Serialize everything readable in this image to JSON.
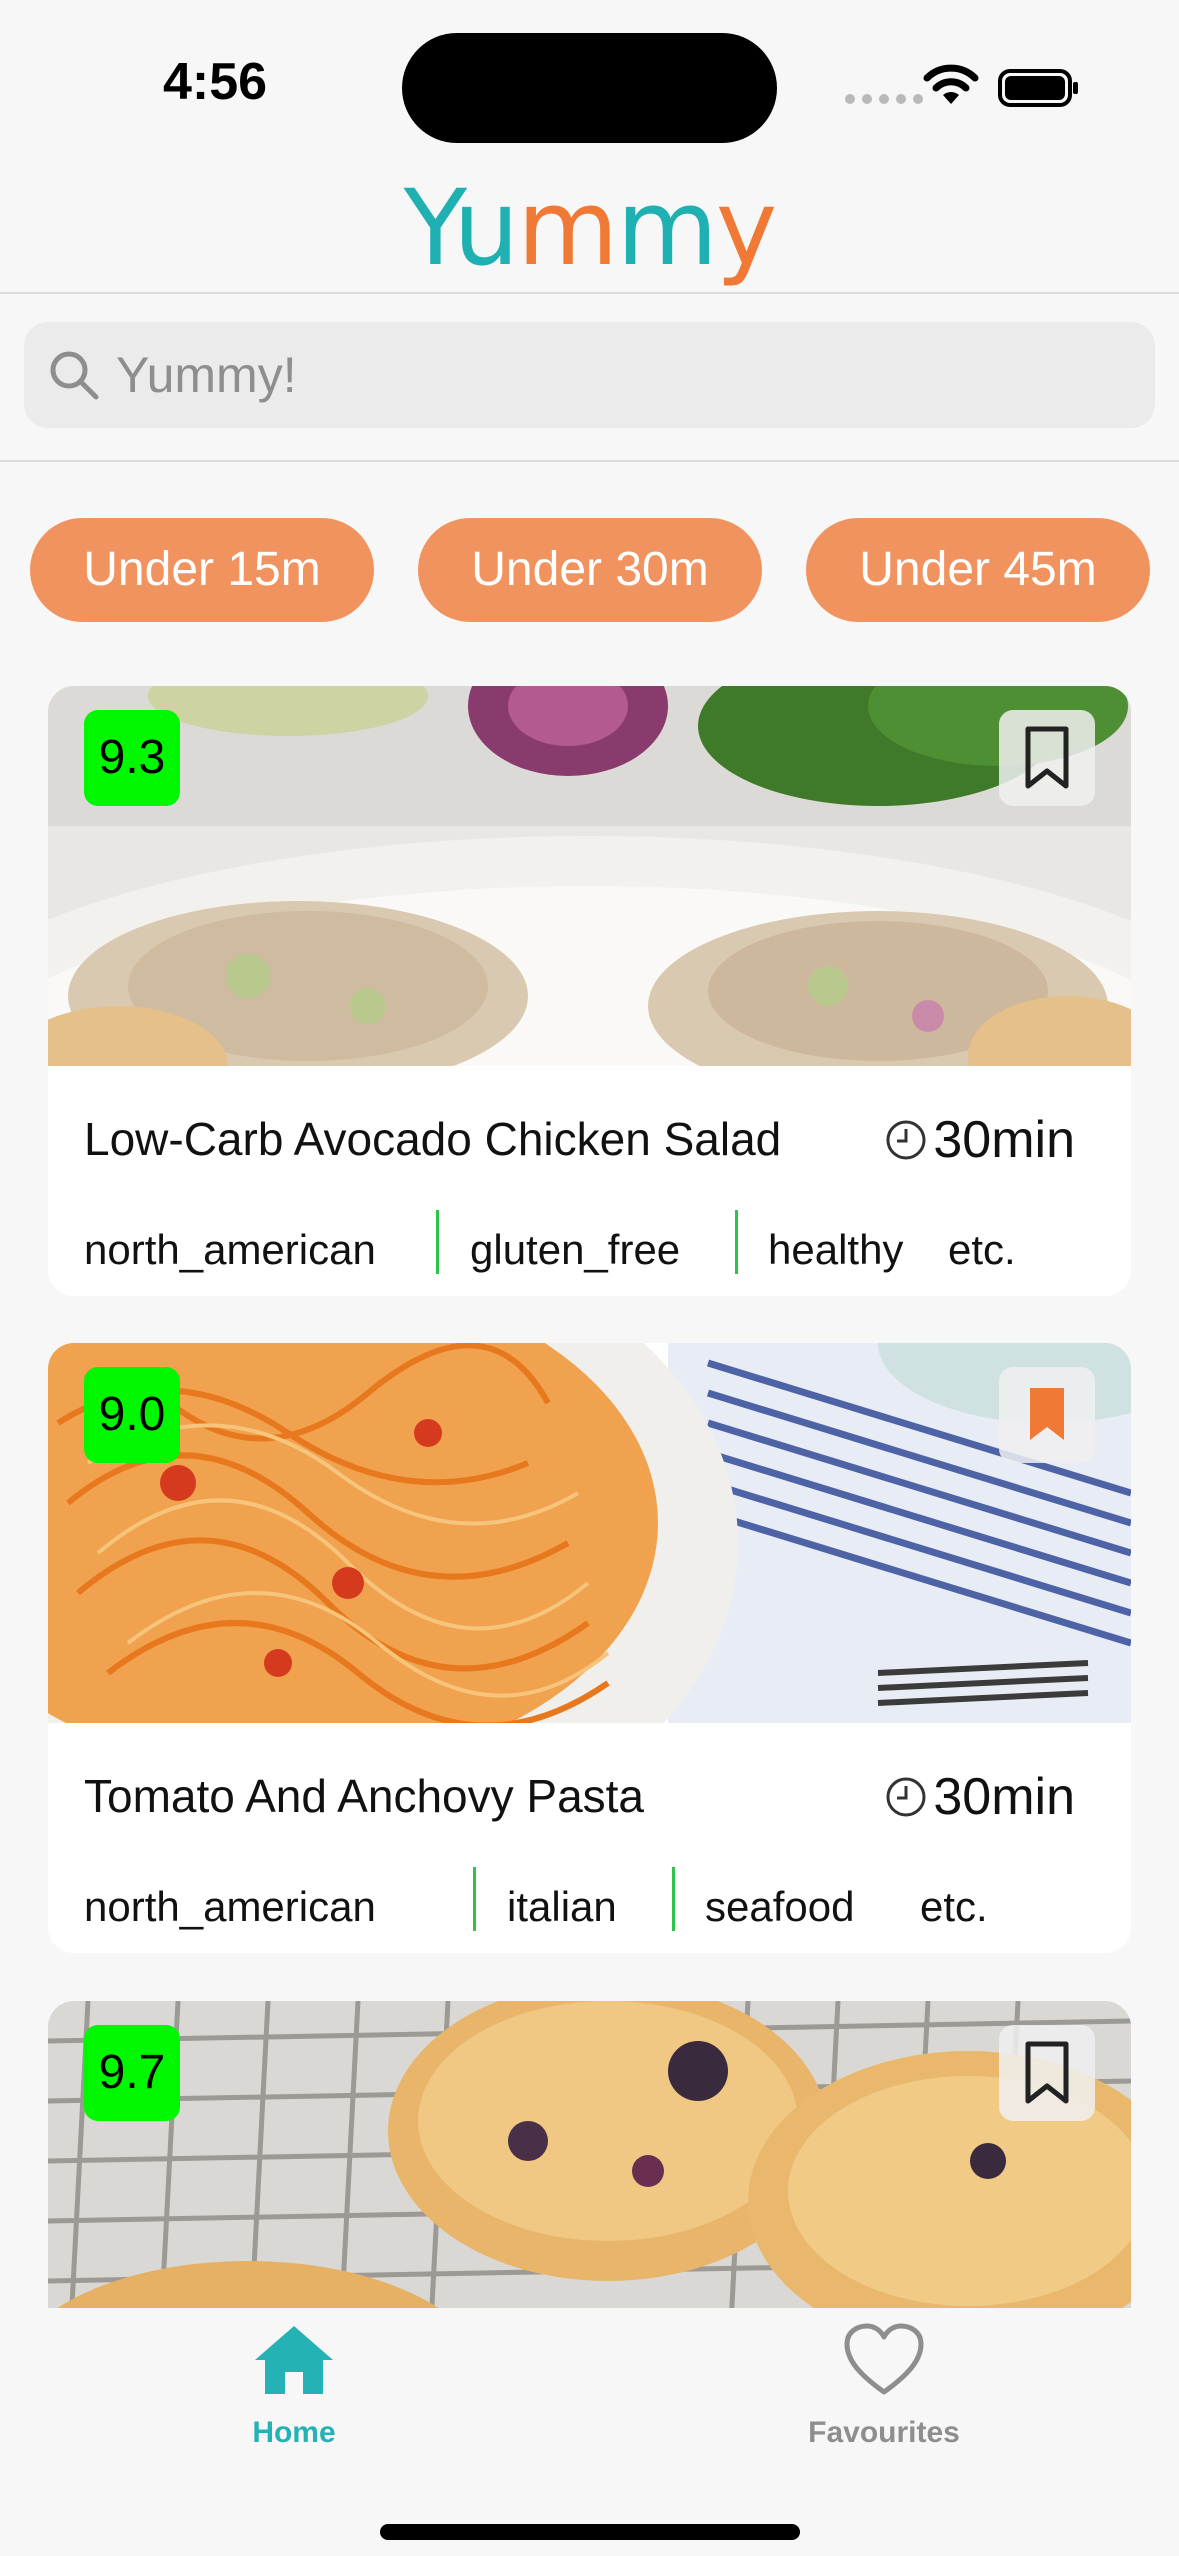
{
  "status_bar": {
    "time": "4:56"
  },
  "header": {
    "logo": [
      "Yu",
      "m",
      "m",
      "y"
    ]
  },
  "search": {
    "placeholder": "Yummy!"
  },
  "filters": [
    "Under 15m",
    "Under 30m",
    "Under 45m"
  ],
  "colors": {
    "accent_teal": "#1fb0b2",
    "accent_orange": "#f07a35",
    "chip_orange": "#f1935f",
    "rating_green": "#00f700",
    "tag_divider_green": "#2ec44a",
    "tab_inactive": "#8e8e8e"
  },
  "recipes": [
    {
      "rating": "9.3",
      "title": "Low-Carb Avocado Chicken Salad",
      "time": "30min",
      "tags": [
        "north_american",
        "gluten_free",
        "healthy"
      ],
      "more": "etc.",
      "bookmarked": false,
      "image": "chicken-salad-photo"
    },
    {
      "rating": "9.0",
      "title": "Tomato And Anchovy Pasta",
      "time": "30min",
      "tags": [
        "north_american",
        "italian",
        "seafood"
      ],
      "more": "etc.",
      "bookmarked": true,
      "image": "spaghetti-photo"
    },
    {
      "rating": "9.7",
      "bookmarked": false,
      "image": "blueberry-muffins-photo"
    }
  ],
  "tab_bar": {
    "tabs": [
      {
        "label": "Home",
        "icon": "home-icon",
        "active": true
      },
      {
        "label": "Favourites",
        "icon": "heart-icon",
        "active": false
      }
    ]
  }
}
